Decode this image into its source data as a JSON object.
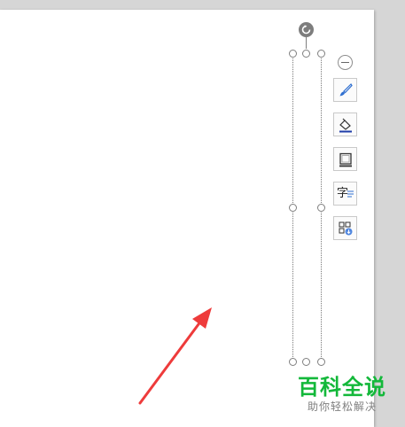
{
  "canvas": {
    "background": "#ffffff",
    "workspace": "#d6d6d6"
  },
  "selection": {
    "border_color": "#7a7a7a"
  },
  "toolbar": {
    "collapse_icon": "minus-circle-icon",
    "tools": [
      {
        "name": "brush-icon"
      },
      {
        "name": "fill-bucket-icon"
      },
      {
        "name": "outline-box-icon"
      },
      {
        "name": "text-format-icon",
        "glyph": "字"
      },
      {
        "name": "layout-options-icon"
      }
    ]
  },
  "annotation": {
    "color": "#ee3b3b",
    "icon": "red-arrow-icon"
  },
  "watermark": {
    "title": "百科全说",
    "subtitle": "助你轻松解决",
    "color": "#13b83a"
  }
}
